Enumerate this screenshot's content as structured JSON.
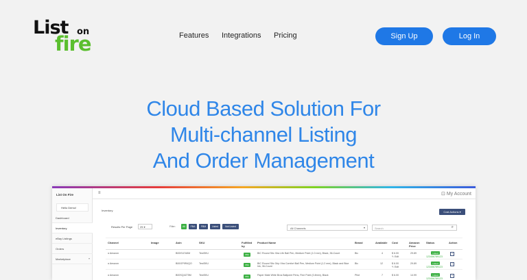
{
  "logo": {
    "word1": "List",
    "word2": "on",
    "word3": "fire"
  },
  "nav": {
    "features": "Features",
    "integrations": "Integrations",
    "pricing": "Pricing"
  },
  "auth": {
    "signup": "Sign Up",
    "login": "Log In"
  },
  "hero": {
    "line1": "Cloud Based Solution For",
    "line2": "Multi-channel Listing",
    "line3": "And Order Management"
  },
  "colors": {
    "accent": "#1f78e6",
    "hero_text": "#2f86e8",
    "logo_green": "#5bbf2f",
    "status_green": "#3cb043",
    "button_dark": "#3b4f7a"
  },
  "app": {
    "brand": "List On Fire",
    "hello": "Hello Demo!",
    "sidebar": [
      {
        "label": "Dashboard"
      },
      {
        "label": "Inventory"
      },
      {
        "label": "eBay Listings"
      },
      {
        "label": "Orders"
      },
      {
        "label": "Marketplace"
      }
    ],
    "my_account": "My Account",
    "page_title": "Inventory",
    "cost_actions": "Cost Actions",
    "results_per_page_label": "Results Per Page",
    "results_per_page_value": "25",
    "filter_label": "Filter:",
    "filters": [
      "All",
      "FBA",
      "FBM",
      "Listed",
      "Not Listed"
    ],
    "channel_select": "All Channels",
    "search_placeholder": "Search",
    "columns": [
      "Channel",
      "Image",
      "Asin",
      "SKU",
      "Fulfilled by",
      "Product Name",
      "Brand",
      "Available",
      "Cost",
      "Amazon Price",
      "Status",
      "Action"
    ],
    "rows": [
      {
        "channel": "Amazon",
        "asin": "B00IS47A5M",
        "sku": "TestSKU",
        "fulfilled": "FBA",
        "name": "BIC Round Stic Xtra Life Ball Pen, Medium Point (1.0 mm), Black, 36-Count",
        "brand": "Bic",
        "available": "4",
        "cost": "$ 6.00",
        "edit": "Edit",
        "price": "29.89",
        "status": "Listed",
        "status_id": "123456789123"
      },
      {
        "channel": "Amazon",
        "asin": "B00OP9R4QO",
        "sku": "TestSKU",
        "fulfilled": "FBA",
        "name": "BIC Round Stic Grip Xtra Comfort Ball Pen, Medium Point (1.2 mm), Black and Blue Ink, 36-Count",
        "brand": "Bic",
        "available": "12",
        "cost": "$ 6.00",
        "edit": "Edit",
        "price": "29.89",
        "status": "Listed",
        "status_id": "123456789123"
      },
      {
        "channel": "Amazon",
        "asin": "B00SQ4Z75M",
        "sku": "TestSKU",
        "fulfilled": "FBA",
        "name": "Paper Mate Write Bros Ballpoint Pens, Fine Point (0.8mm), Black",
        "brand": "Pilot",
        "available": "7",
        "cost": "$ 6.00",
        "edit": "",
        "price": "14.99",
        "status": "Listed",
        "status_id": "123456789123"
      }
    ]
  }
}
